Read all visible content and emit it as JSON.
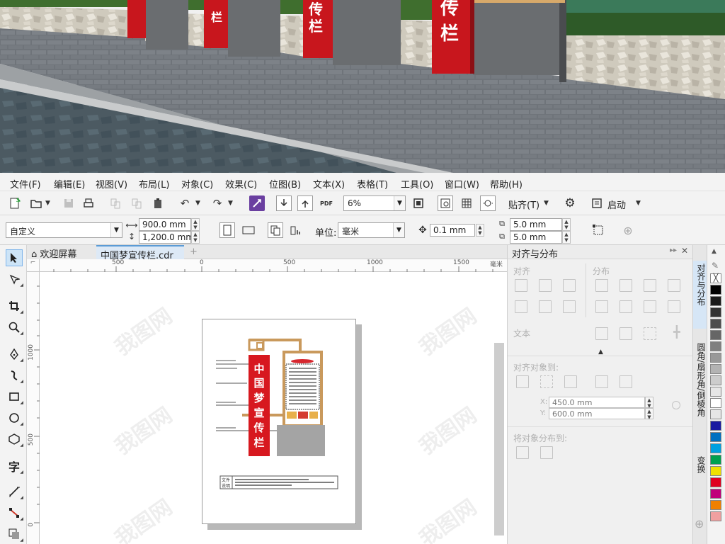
{
  "menu": [
    "文件(F)",
    "编辑(E)",
    "视图(V)",
    "布局(L)",
    "对象(C)",
    "效果(C)",
    "位图(B)",
    "文本(X)",
    "表格(T)",
    "工具(O)",
    "窗口(W)",
    "帮助(H)"
  ],
  "toolbar": {
    "zoom": "6%",
    "snap_label": "贴齐(T)",
    "launch_label": "启动"
  },
  "propbar": {
    "preset": "自定义",
    "width": "900.0 mm",
    "height": "1,200.0 mm",
    "unit_label": "单位:",
    "unit": "毫米",
    "nudge": "0.1 mm",
    "dup_x": "5.0 mm",
    "dup_y": "5.0 mm"
  },
  "tabs": {
    "welcome": "欢迎屏幕",
    "document": "中国梦宣传栏.cdr",
    "add": "+"
  },
  "ruler": {
    "h_ticks": [
      "500",
      "0",
      "500",
      "1000",
      "1500"
    ],
    "h_unit": "毫米",
    "v_ticks": [
      "1000",
      "500",
      "0"
    ]
  },
  "artwork": {
    "vertical_text": [
      "中",
      "国",
      "梦",
      "宣",
      "传",
      "栏"
    ],
    "note_line1": "文件",
    "note_line2": "说明"
  },
  "photo": {
    "sign_texts": [
      "传",
      "栏"
    ]
  },
  "docker": {
    "title": "对齐与分布",
    "align_section": "对齐",
    "distribute_section": "分布",
    "text_section": "文本",
    "align_to_label": "对齐对象到:",
    "x_value": "450.0 mm",
    "y_value": "600.0 mm",
    "x_label": "X:",
    "y_label": "Y:",
    "distribute_to_label": "将对象分布到:"
  },
  "side_tabs": [
    "对齐与分布",
    "圆角/扇形角/倒棱角",
    "变换"
  ],
  "palette_colors": [
    "#ffffff",
    "#000000",
    "#1a1a1a",
    "#333333",
    "#4d4d4d",
    "#666666",
    "#808080",
    "#999999",
    "#b3b3b3",
    "#cccccc",
    "#e6e6e6",
    "#ffffff",
    "#e6e6e6",
    "#1a1aa0",
    "#0070c0",
    "#00a0e0",
    "#00a050",
    "#f0e000",
    "#e00020",
    "#c0007a",
    "#f08000",
    "#f0a0a0"
  ],
  "watermark": "我图网"
}
